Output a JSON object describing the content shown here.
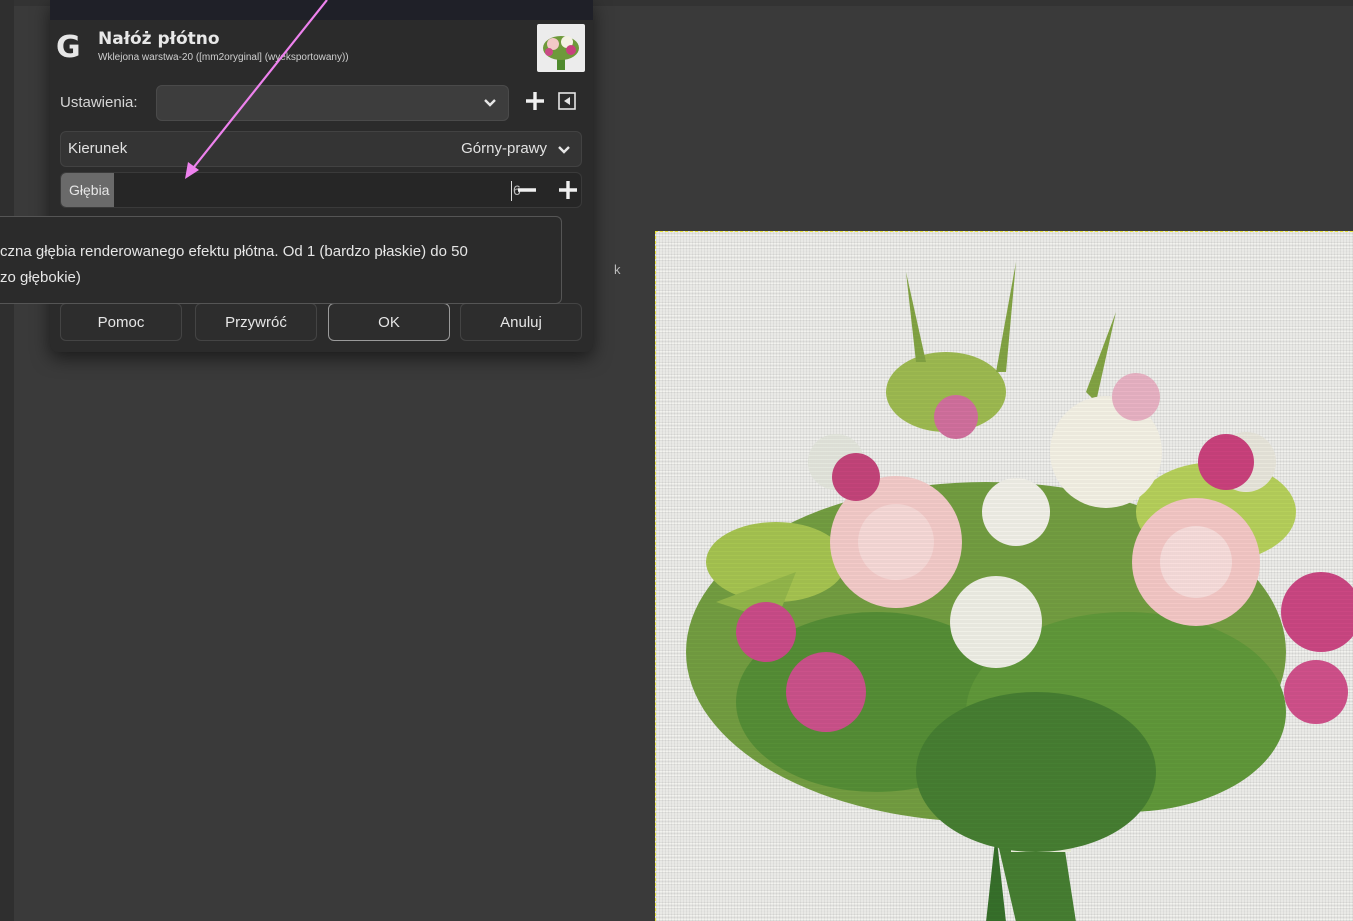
{
  "dialog": {
    "title": "Nałóż płótno",
    "subtitle": "Wklejona warstwa-20 ([mm2oryginal] (wyeksportowany))",
    "logo_letter": "G",
    "settings_label": "Ustawienia:",
    "settings_value": "",
    "direction_label": "Kierunek",
    "direction_value": "Górny-prawy",
    "depth_label": "Głębia",
    "depth_value": "6",
    "depth_min": 1,
    "depth_max": 50,
    "tooltip_line1": "czna głębia renderowanego efektu płótna. Od 1 (bardzo płaskie) do 50",
    "tooltip_line2": "zo głębokie)",
    "tooltip_edge_char": "k",
    "buttons": {
      "help": "Pomoc",
      "reset": "Przywróć",
      "ok": "OK",
      "cancel": "Anuluj"
    }
  },
  "icons": [
    "chevron-down-icon",
    "plus-icon",
    "minus-icon",
    "collapse-icon",
    "gimp-logo-icon",
    "annotation-arrow"
  ],
  "colors": {
    "background": "#3a3a3a",
    "dialog": "#2b2b2b",
    "annotation_arrow": "#ee82ee",
    "selection_border": "#e8e23a"
  }
}
